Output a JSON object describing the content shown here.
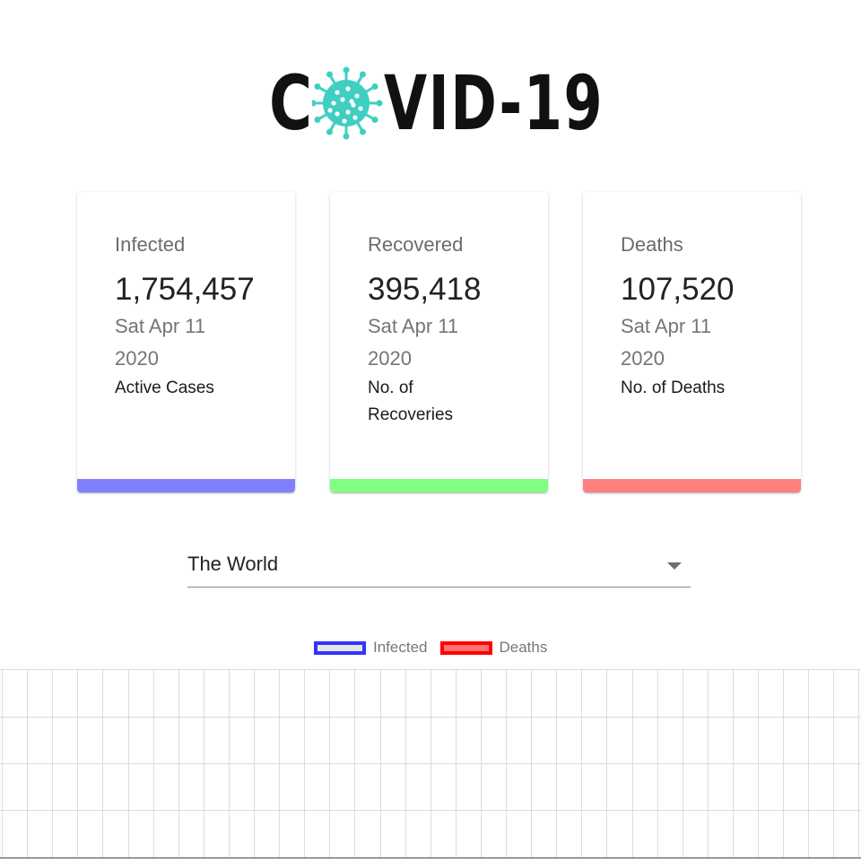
{
  "header": {
    "logo_text_c": "C",
    "logo_text_rest": "VID-19",
    "logo_icon": "virus-icon",
    "virus_color": "#3fcfc1"
  },
  "cards": [
    {
      "label": "Infected",
      "value": "1,754,457",
      "date": "Sat Apr 11 2020",
      "desc": "Active Cases",
      "color": "#8080ff"
    },
    {
      "label": "Recovered",
      "value": "395,418",
      "date": "Sat Apr 11 2020",
      "desc": "No. of Recoveries",
      "color": "#80ff80"
    },
    {
      "label": "Deaths",
      "value": "107,520",
      "date": "Sat Apr 11 2020",
      "desc": "No. of Deaths",
      "color": "#ff8080"
    }
  ],
  "country_select": {
    "selected": "The World",
    "icon": "arrow-drop-down-icon"
  },
  "chart_data": {
    "type": "line",
    "series": [
      {
        "name": "Infected",
        "stroke": "#3333ff",
        "fill": "#e6e6e6",
        "values": []
      },
      {
        "name": "Deaths",
        "stroke": "#ff0000",
        "fill": "#ff7070",
        "values": []
      }
    ],
    "grid": true,
    "legend_placement": "top-center"
  }
}
